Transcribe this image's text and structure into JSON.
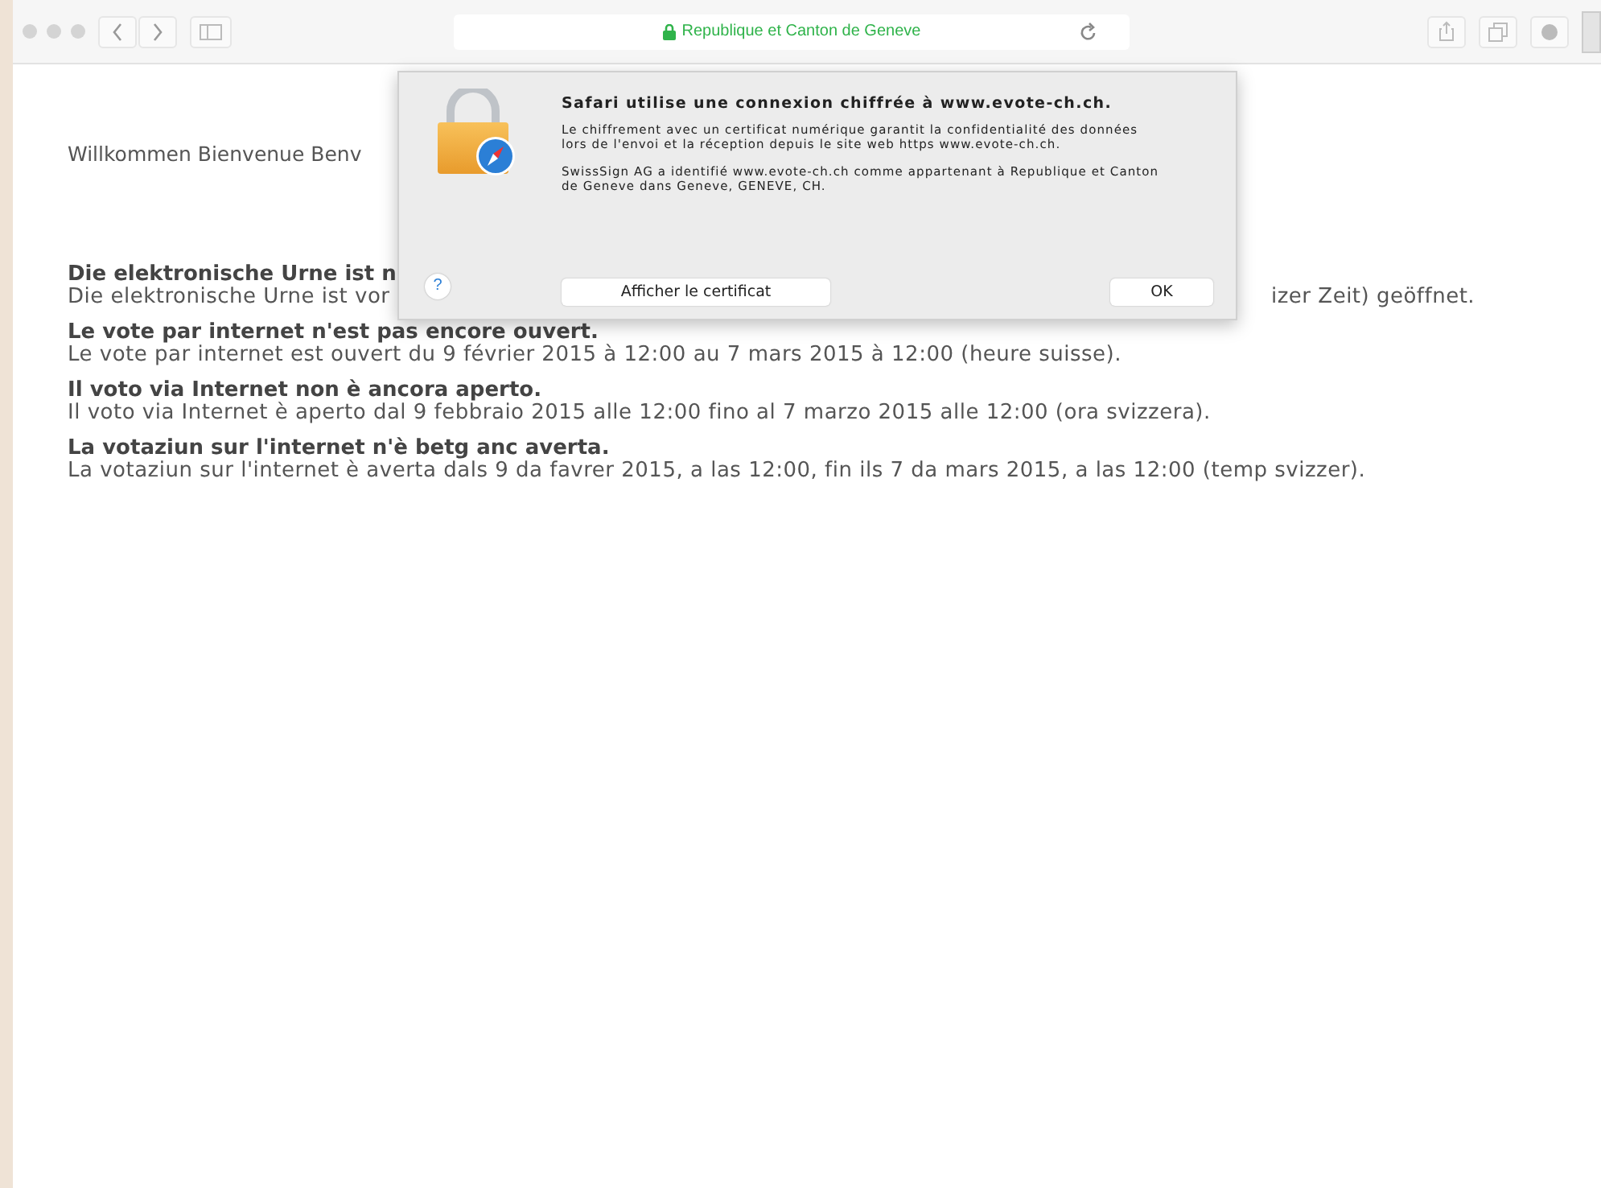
{
  "toolbar": {
    "address": "Republique et Canton de Geneve",
    "secure": true
  },
  "page": {
    "welcome": "Willkommen Bienvenue Benv",
    "notices": [
      {
        "heading": "Die elektronische Urne ist n",
        "body": "Die elektronische Urne ist vor",
        "body_tail": "izer Zeit) geöffnet."
      },
      {
        "heading": "Le vote par internet n'est pas encore ouvert.",
        "body": "Le vote par internet est ouvert du 9 février 2015 à 12:00 au 7 mars 2015 à 12:00 (heure suisse)."
      },
      {
        "heading": "Il voto via Internet non è ancora aperto.",
        "body": "Il voto via Internet è aperto dal 9 febbraio 2015 alle 12:00 fino al 7 marzo 2015 alle 12:00 (ora svizzera)."
      },
      {
        "heading": "La votaziun sur l'internet n'è betg anc averta.",
        "body": "La votaziun sur l'internet è averta dals 9 da favrer 2015, a las 12:00, fin ils 7 da mars 2015, a las 12:00 (temp svizzer)."
      }
    ]
  },
  "dialog": {
    "title": "Safari utilise une connexion chiffrée à www.evote-ch.ch.",
    "paragraphs": [
      "Le chiffrement avec un certificat numérique garantit la confidentialité des données lors de l'envoi et la réception depuis le site web https www.evote-ch.ch.",
      "SwissSign AG a identifié www.evote-ch.ch comme appartenant à Republique et Canton de Geneve dans Geneve, GENEVE, CH."
    ],
    "help": "?",
    "buttons": [
      "Afficher le certificat",
      "OK"
    ]
  }
}
